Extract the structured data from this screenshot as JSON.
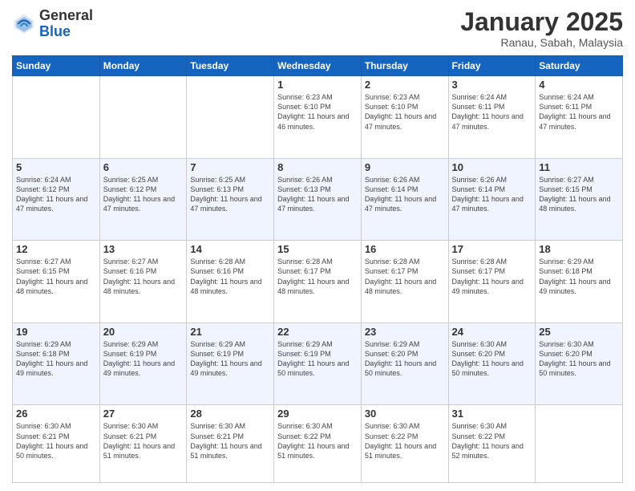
{
  "header": {
    "logo_general": "General",
    "logo_blue": "Blue",
    "title": "January 2025",
    "subtitle": "Ranau, Sabah, Malaysia"
  },
  "days_of_week": [
    "Sunday",
    "Monday",
    "Tuesday",
    "Wednesday",
    "Thursday",
    "Friday",
    "Saturday"
  ],
  "weeks": [
    [
      {
        "day": "",
        "sunrise": "",
        "sunset": "",
        "daylight": "",
        "empty": true
      },
      {
        "day": "",
        "sunrise": "",
        "sunset": "",
        "daylight": "",
        "empty": true
      },
      {
        "day": "",
        "sunrise": "",
        "sunset": "",
        "daylight": "",
        "empty": true
      },
      {
        "day": "1",
        "sunrise": "Sunrise: 6:23 AM",
        "sunset": "Sunset: 6:10 PM",
        "daylight": "Daylight: 11 hours and 46 minutes."
      },
      {
        "day": "2",
        "sunrise": "Sunrise: 6:23 AM",
        "sunset": "Sunset: 6:10 PM",
        "daylight": "Daylight: 11 hours and 47 minutes."
      },
      {
        "day": "3",
        "sunrise": "Sunrise: 6:24 AM",
        "sunset": "Sunset: 6:11 PM",
        "daylight": "Daylight: 11 hours and 47 minutes."
      },
      {
        "day": "4",
        "sunrise": "Sunrise: 6:24 AM",
        "sunset": "Sunset: 6:11 PM",
        "daylight": "Daylight: 11 hours and 47 minutes."
      }
    ],
    [
      {
        "day": "5",
        "sunrise": "Sunrise: 6:24 AM",
        "sunset": "Sunset: 6:12 PM",
        "daylight": "Daylight: 11 hours and 47 minutes."
      },
      {
        "day": "6",
        "sunrise": "Sunrise: 6:25 AM",
        "sunset": "Sunset: 6:12 PM",
        "daylight": "Daylight: 11 hours and 47 minutes."
      },
      {
        "day": "7",
        "sunrise": "Sunrise: 6:25 AM",
        "sunset": "Sunset: 6:13 PM",
        "daylight": "Daylight: 11 hours and 47 minutes."
      },
      {
        "day": "8",
        "sunrise": "Sunrise: 6:26 AM",
        "sunset": "Sunset: 6:13 PM",
        "daylight": "Daylight: 11 hours and 47 minutes."
      },
      {
        "day": "9",
        "sunrise": "Sunrise: 6:26 AM",
        "sunset": "Sunset: 6:14 PM",
        "daylight": "Daylight: 11 hours and 47 minutes."
      },
      {
        "day": "10",
        "sunrise": "Sunrise: 6:26 AM",
        "sunset": "Sunset: 6:14 PM",
        "daylight": "Daylight: 11 hours and 47 minutes."
      },
      {
        "day": "11",
        "sunrise": "Sunrise: 6:27 AM",
        "sunset": "Sunset: 6:15 PM",
        "daylight": "Daylight: 11 hours and 48 minutes."
      }
    ],
    [
      {
        "day": "12",
        "sunrise": "Sunrise: 6:27 AM",
        "sunset": "Sunset: 6:15 PM",
        "daylight": "Daylight: 11 hours and 48 minutes."
      },
      {
        "day": "13",
        "sunrise": "Sunrise: 6:27 AM",
        "sunset": "Sunset: 6:16 PM",
        "daylight": "Daylight: 11 hours and 48 minutes."
      },
      {
        "day": "14",
        "sunrise": "Sunrise: 6:28 AM",
        "sunset": "Sunset: 6:16 PM",
        "daylight": "Daylight: 11 hours and 48 minutes."
      },
      {
        "day": "15",
        "sunrise": "Sunrise: 6:28 AM",
        "sunset": "Sunset: 6:17 PM",
        "daylight": "Daylight: 11 hours and 48 minutes."
      },
      {
        "day": "16",
        "sunrise": "Sunrise: 6:28 AM",
        "sunset": "Sunset: 6:17 PM",
        "daylight": "Daylight: 11 hours and 48 minutes."
      },
      {
        "day": "17",
        "sunrise": "Sunrise: 6:28 AM",
        "sunset": "Sunset: 6:17 PM",
        "daylight": "Daylight: 11 hours and 49 minutes."
      },
      {
        "day": "18",
        "sunrise": "Sunrise: 6:29 AM",
        "sunset": "Sunset: 6:18 PM",
        "daylight": "Daylight: 11 hours and 49 minutes."
      }
    ],
    [
      {
        "day": "19",
        "sunrise": "Sunrise: 6:29 AM",
        "sunset": "Sunset: 6:18 PM",
        "daylight": "Daylight: 11 hours and 49 minutes."
      },
      {
        "day": "20",
        "sunrise": "Sunrise: 6:29 AM",
        "sunset": "Sunset: 6:19 PM",
        "daylight": "Daylight: 11 hours and 49 minutes."
      },
      {
        "day": "21",
        "sunrise": "Sunrise: 6:29 AM",
        "sunset": "Sunset: 6:19 PM",
        "daylight": "Daylight: 11 hours and 49 minutes."
      },
      {
        "day": "22",
        "sunrise": "Sunrise: 6:29 AM",
        "sunset": "Sunset: 6:19 PM",
        "daylight": "Daylight: 11 hours and 50 minutes."
      },
      {
        "day": "23",
        "sunrise": "Sunrise: 6:29 AM",
        "sunset": "Sunset: 6:20 PM",
        "daylight": "Daylight: 11 hours and 50 minutes."
      },
      {
        "day": "24",
        "sunrise": "Sunrise: 6:30 AM",
        "sunset": "Sunset: 6:20 PM",
        "daylight": "Daylight: 11 hours and 50 minutes."
      },
      {
        "day": "25",
        "sunrise": "Sunrise: 6:30 AM",
        "sunset": "Sunset: 6:20 PM",
        "daylight": "Daylight: 11 hours and 50 minutes."
      }
    ],
    [
      {
        "day": "26",
        "sunrise": "Sunrise: 6:30 AM",
        "sunset": "Sunset: 6:21 PM",
        "daylight": "Daylight: 11 hours and 50 minutes."
      },
      {
        "day": "27",
        "sunrise": "Sunrise: 6:30 AM",
        "sunset": "Sunset: 6:21 PM",
        "daylight": "Daylight: 11 hours and 51 minutes."
      },
      {
        "day": "28",
        "sunrise": "Sunrise: 6:30 AM",
        "sunset": "Sunset: 6:21 PM",
        "daylight": "Daylight: 11 hours and 51 minutes."
      },
      {
        "day": "29",
        "sunrise": "Sunrise: 6:30 AM",
        "sunset": "Sunset: 6:22 PM",
        "daylight": "Daylight: 11 hours and 51 minutes."
      },
      {
        "day": "30",
        "sunrise": "Sunrise: 6:30 AM",
        "sunset": "Sunset: 6:22 PM",
        "daylight": "Daylight: 11 hours and 51 minutes."
      },
      {
        "day": "31",
        "sunrise": "Sunrise: 6:30 AM",
        "sunset": "Sunset: 6:22 PM",
        "daylight": "Daylight: 11 hours and 52 minutes."
      },
      {
        "day": "",
        "sunrise": "",
        "sunset": "",
        "daylight": "",
        "empty": true
      }
    ]
  ]
}
